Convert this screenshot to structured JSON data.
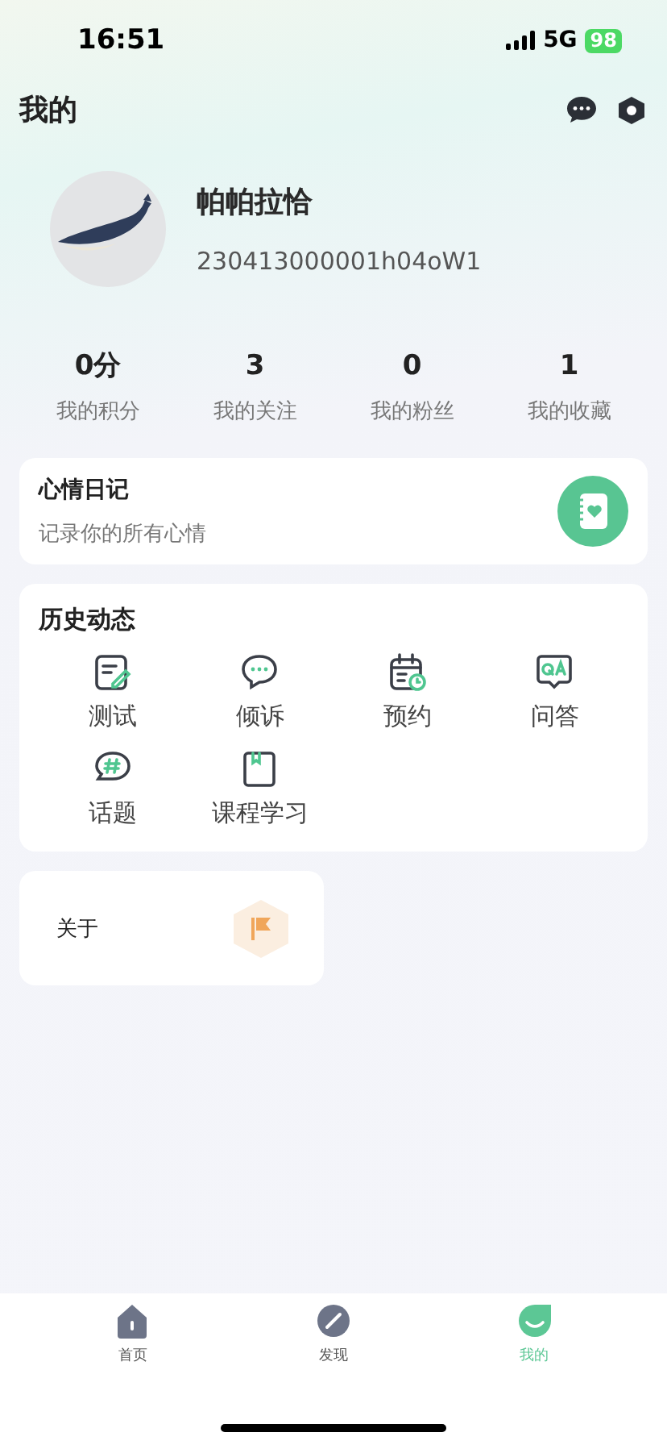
{
  "status_bar": {
    "time": "16:51",
    "network": "5G",
    "battery": "98"
  },
  "header": {
    "title": "我的"
  },
  "profile": {
    "name": "帕帕拉恰",
    "id": "230413000001h04oW1"
  },
  "stats": [
    {
      "value": "0分",
      "label": "我的积分"
    },
    {
      "value": "3",
      "label": "我的关注"
    },
    {
      "value": "0",
      "label": "我的粉丝"
    },
    {
      "value": "1",
      "label": "我的收藏"
    }
  ],
  "mood_diary": {
    "title": "心情日记",
    "subtitle": "记录你的所有心情"
  },
  "history": {
    "title": "历史动态",
    "items": [
      {
        "kind": "edit",
        "label": "测试"
      },
      {
        "kind": "chat",
        "label": "倾诉"
      },
      {
        "kind": "calendar",
        "label": "预约"
      },
      {
        "kind": "qa",
        "label": "问答"
      },
      {
        "kind": "topic",
        "label": "话题"
      },
      {
        "kind": "book",
        "label": "课程学习"
      }
    ]
  },
  "about": {
    "label": "关于"
  },
  "tab_bar": [
    {
      "kind": "home",
      "label": "首页",
      "selected": false
    },
    {
      "kind": "discover",
      "label": "发现",
      "selected": false
    },
    {
      "kind": "me",
      "label": "我的",
      "selected": true
    }
  ]
}
